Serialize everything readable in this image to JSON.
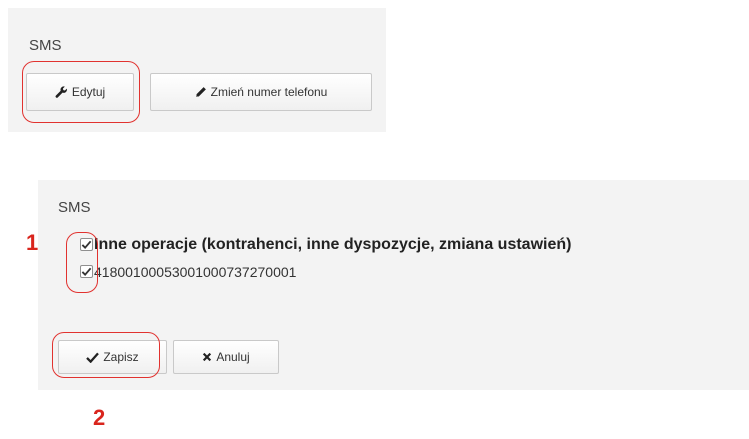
{
  "top_panel": {
    "title": "SMS",
    "edit_button_label": "Edytuj",
    "change_phone_button_label": "Zmień numer telefonu"
  },
  "bottom_panel": {
    "title": "SMS",
    "options": [
      {
        "label": "Inne operacje (kontrahenci, inne dyspozycje, zmiana ustawień)",
        "checked": true
      },
      {
        "label": "41800100053001000737270001",
        "checked": true
      }
    ],
    "save_button_label": "Zapisz",
    "cancel_button_label": "Anuluj"
  },
  "annotations": {
    "step_1": "1",
    "step_2": "2",
    "highlight_color": "#e1322f"
  },
  "icons": {
    "edit": "wrench-icon",
    "change_phone": "pencil-icon",
    "save": "checkmark-icon",
    "cancel": "x-icon"
  }
}
